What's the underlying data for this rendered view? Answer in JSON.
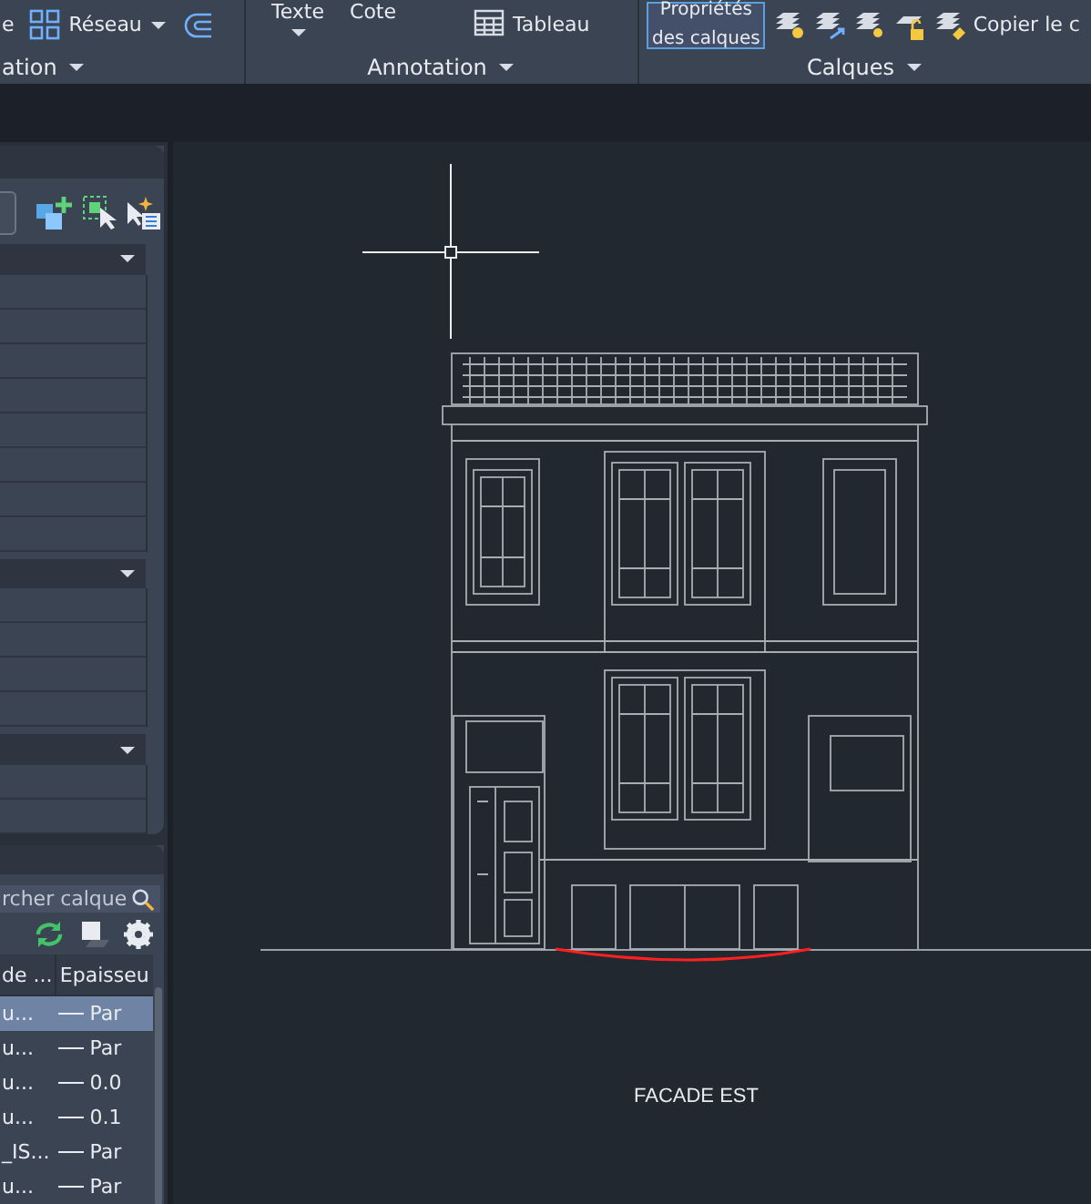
{
  "ribbon": {
    "panels": [
      {
        "tools": [
          {
            "kind": "text",
            "label": "e"
          },
          {
            "kind": "grid",
            "label": "Réseau",
            "caret": true
          },
          {
            "kind": "offset"
          }
        ],
        "title": "ation"
      },
      {
        "tools": [
          {
            "kind": "cut",
            "label": "Texte",
            "caret": true
          },
          {
            "kind": "cut",
            "label": "Cote"
          },
          {
            "kind": "table",
            "label": "Tableau"
          }
        ],
        "title": "Annotation"
      },
      {
        "tools": [
          {
            "kind": "boxed",
            "label": "Propriétés",
            "label2": "des calques"
          },
          {
            "kind": "layer-bulb"
          },
          {
            "kind": "layer-arrow"
          },
          {
            "kind": "layer-sun"
          },
          {
            "kind": "layer-lock"
          },
          {
            "kind": "layer-brush",
            "label": "Copier le c"
          }
        ],
        "title": "Calques"
      }
    ]
  },
  "layers_palette": {
    "search": {
      "placeholder": "rcher calque"
    },
    "columns": [
      "de ...",
      "Epaisseu"
    ],
    "rows": [
      {
        "name": "u...",
        "lineweight": "Par",
        "selected": true
      },
      {
        "name": "u...",
        "lineweight": "Par",
        "selected": false
      },
      {
        "name": "u...",
        "lineweight": "0.0",
        "selected": false
      },
      {
        "name": "u...",
        "lineweight": "0.1",
        "selected": false
      },
      {
        "name": "_IS...",
        "lineweight": "Par",
        "selected": false
      },
      {
        "name": "u...",
        "lineweight": "Par",
        "selected": false
      }
    ]
  },
  "drawing": {
    "label": "FACADE EST"
  }
}
